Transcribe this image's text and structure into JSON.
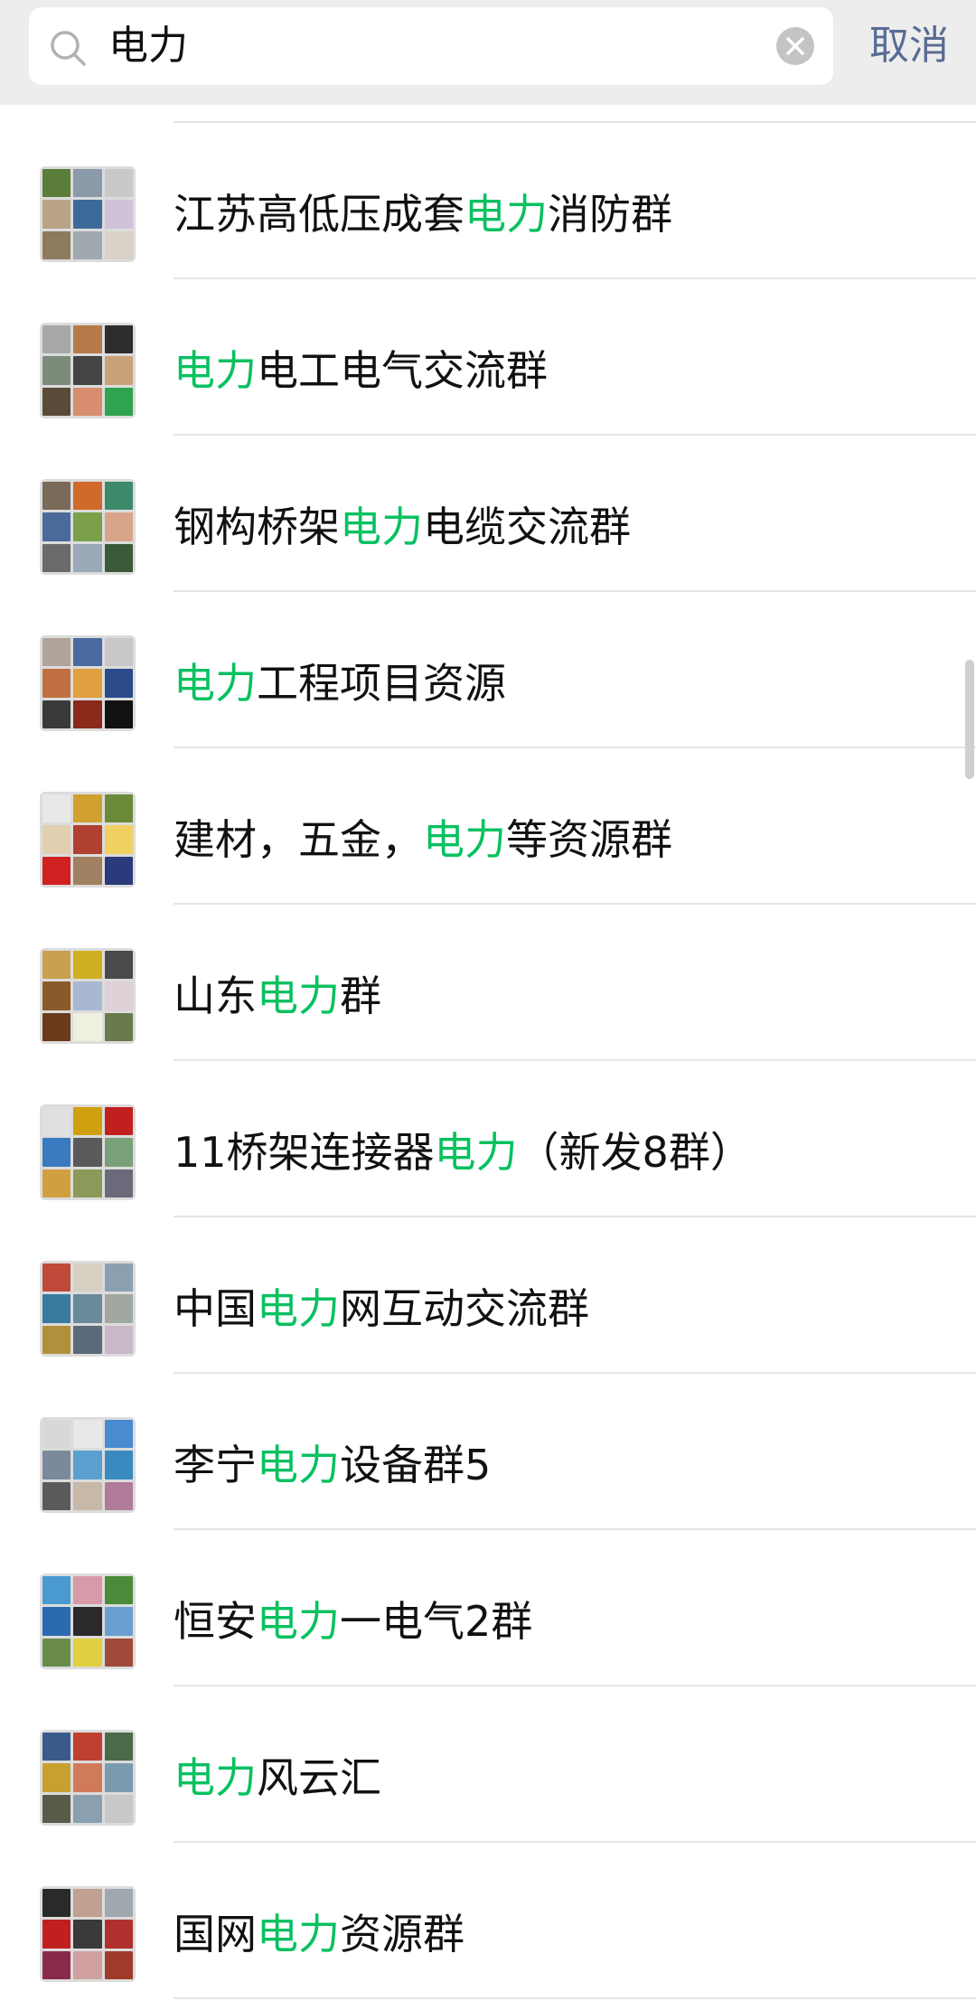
{
  "search": {
    "value": "电力",
    "cancel_label": "取消"
  },
  "results": [
    {
      "before": "江苏高低压成套",
      "keyword": "电力",
      "after": "消防群",
      "tiles": [
        "#5a7d3a",
        "#8a9aa8",
        "#c9c9c9",
        "#b9a386",
        "#3e6a9a",
        "#d0c2d8",
        "#8c7b5c",
        "#a0a8b0",
        "#d9d3c7"
      ]
    },
    {
      "before": "",
      "keyword": "电力",
      "after": "电工电气交流群",
      "tiles": [
        "#a8a8a8",
        "#b57a4a",
        "#2d2d2d",
        "#7c8c7a",
        "#444444",
        "#c9a27a",
        "#5a4a3a",
        "#d88e6e",
        "#2fa34f"
      ]
    },
    {
      "before": "钢构桥架",
      "keyword": "电力",
      "after": "电缆交流群",
      "tiles": [
        "#7a6a5a",
        "#d06a2a",
        "#3d8a6a",
        "#4a6a9a",
        "#7aa04a",
        "#d9a58a",
        "#6a6a6a",
        "#9aa8b8",
        "#3a5a3a"
      ]
    },
    {
      "before": "",
      "keyword": "电力",
      "after": "工程项目资源",
      "tiles": [
        "#b0a49a",
        "#4a6aa0",
        "#c8c8c8",
        "#c07040",
        "#e0a040",
        "#2a4a8a",
        "#3a3a3a",
        "#8a2a1a",
        "#111111"
      ]
    },
    {
      "before": "建材，五金，",
      "keyword": "电力",
      "after": "等资源群",
      "tiles": [
        "#e8e8e8",
        "#d0a030",
        "#6a8a3a",
        "#e0d0b0",
        "#b04030",
        "#f0d060",
        "#d02020",
        "#a08060",
        "#2a3a7a"
      ]
    },
    {
      "before": "山东",
      "keyword": "电力",
      "after": "群",
      "tiles": [
        "#c8a050",
        "#d0b020",
        "#4a4a4a",
        "#8a5a2a",
        "#a8b8d0",
        "#e0d0d8",
        "#6a3a1a",
        "#f0f0e0",
        "#6a7a4a"
      ]
    },
    {
      "before": "11桥架连接器",
      "keyword": "电力",
      "after": "（新发8群）",
      "tiles": [
        "#e0e0e0",
        "#d0a010",
        "#c02020",
        "#3a7ac0",
        "#5a5a5a",
        "#7aa07a",
        "#d0a040",
        "#8a9a5a",
        "#6a6a7a"
      ]
    },
    {
      "before": "中国",
      "keyword": "电力",
      "after": "网互动交流群",
      "tiles": [
        "#c04a3a",
        "#d8d0c0",
        "#8aa0b0",
        "#3a7aa0",
        "#6a8a9a",
        "#a0a8a0",
        "#b0903a",
        "#5a6a7a",
        "#c8b8c8"
      ]
    },
    {
      "before": "李宁",
      "keyword": "电力",
      "after": "设备群5",
      "tiles": [
        "#d8d8d8",
        "#e8e8e8",
        "#4a8ad0",
        "#7a8a9a",
        "#5aa0d0",
        "#3a8ac0",
        "#5a5a5a",
        "#c8b8a8",
        "#b07a9a"
      ]
    },
    {
      "before": "恒安",
      "keyword": "电力",
      "after": "一电气2群",
      "tiles": [
        "#4a9ad0",
        "#d89aa8",
        "#4a8a3a",
        "#2a6ab0",
        "#2a2a2a",
        "#6aa0d0",
        "#6a8a4a",
        "#e0d040",
        "#a04a3a"
      ]
    },
    {
      "before": "",
      "keyword": "电力",
      "after": "风云汇",
      "tiles": [
        "#3a5a8a",
        "#c04030",
        "#4a6a4a",
        "#c8a030",
        "#d07a5a",
        "#7a9ab0",
        "#5a5a4a",
        "#8aa0b0",
        "#c8c8c8"
      ]
    },
    {
      "before": "国网",
      "keyword": "电力",
      "after": "资源群",
      "tiles": [
        "#2a2a2a",
        "#c0a090",
        "#a0a8b0",
        "#c02020",
        "#3a3a3a",
        "#b03030",
        "#8a2a4a",
        "#d0a0a0",
        "#a03a2a"
      ]
    }
  ],
  "colors": {
    "keyword_highlight": "#07c160",
    "cancel": "#576b95",
    "header_bg": "#ededed"
  },
  "icons": {
    "search": "search-icon",
    "clear": "clear-icon"
  }
}
